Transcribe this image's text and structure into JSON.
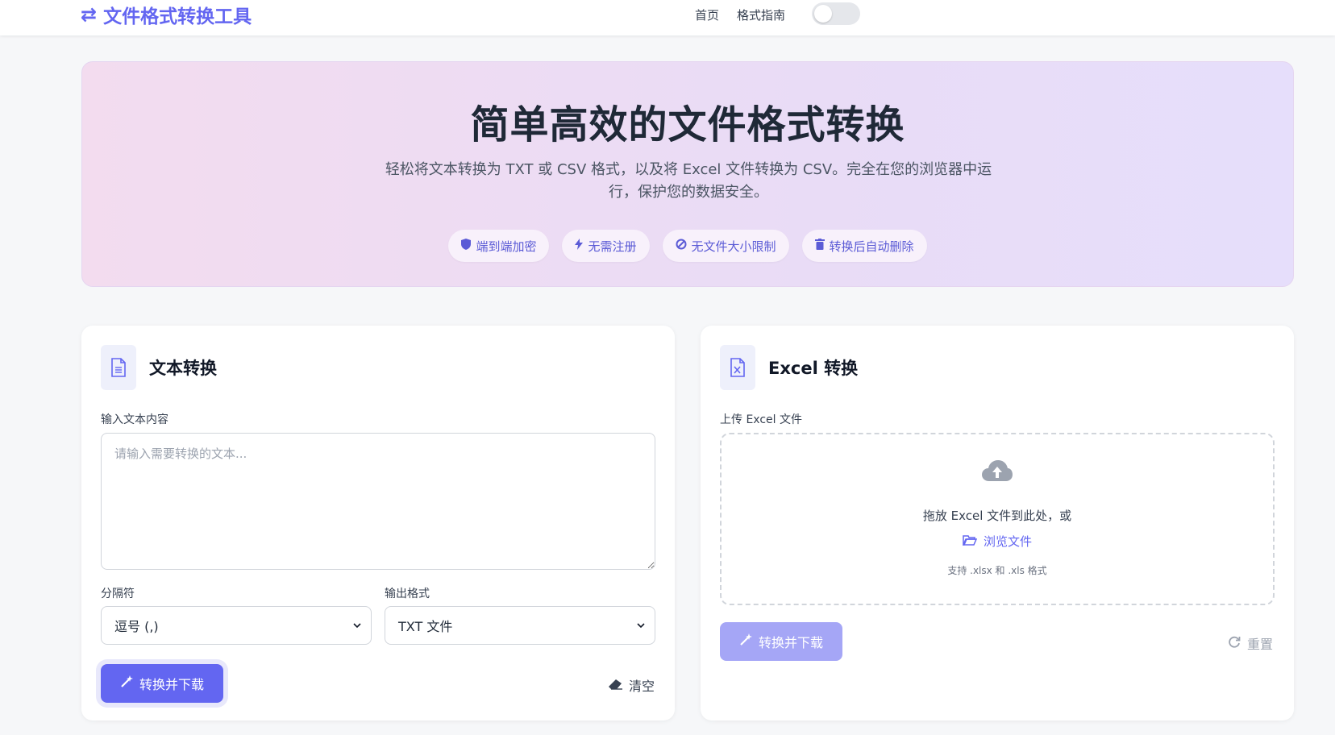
{
  "nav": {
    "brand": "文件格式转换工具",
    "brand_icon": "swap-arrows-icon",
    "links": [
      "首页",
      "格式指南"
    ],
    "theme_toggle_on": false
  },
  "hero": {
    "title": "简单高效的文件格式转换",
    "subtitle": "轻松将文本转换为 TXT 或 CSV 格式，以及将 Excel 文件转换为 CSV。完全在您的浏览器中运行，保护您的数据安全。",
    "badges": [
      {
        "icon": "shield-icon",
        "label": "端到端加密"
      },
      {
        "icon": "bolt-icon",
        "label": "无需注册"
      },
      {
        "icon": "ban-icon",
        "label": "无文件大小限制"
      },
      {
        "icon": "trash-icon",
        "label": "转换后自动删除"
      }
    ]
  },
  "text_card": {
    "title": "文本转换",
    "input_label": "输入文本内容",
    "input_placeholder": "请输入需要转换的文本...",
    "input_value": "",
    "delimiter_label": "分隔符",
    "delimiter_value": "逗号 (,)",
    "format_label": "输出格式",
    "format_value": "TXT 文件",
    "convert_button": "转换并下载",
    "clear_button": "清空"
  },
  "excel_card": {
    "title": "Excel 转换",
    "upload_label": "上传 Excel 文件",
    "drop_text": "拖放 Excel 文件到此处，或",
    "browse_text": "浏览文件",
    "hint": "支持 .xlsx 和 .xls 格式",
    "convert_button": "转换并下载",
    "reset_button": "重置"
  },
  "colors": {
    "accent": "#6366f1",
    "accent_disabled": "#a5a6f6"
  }
}
